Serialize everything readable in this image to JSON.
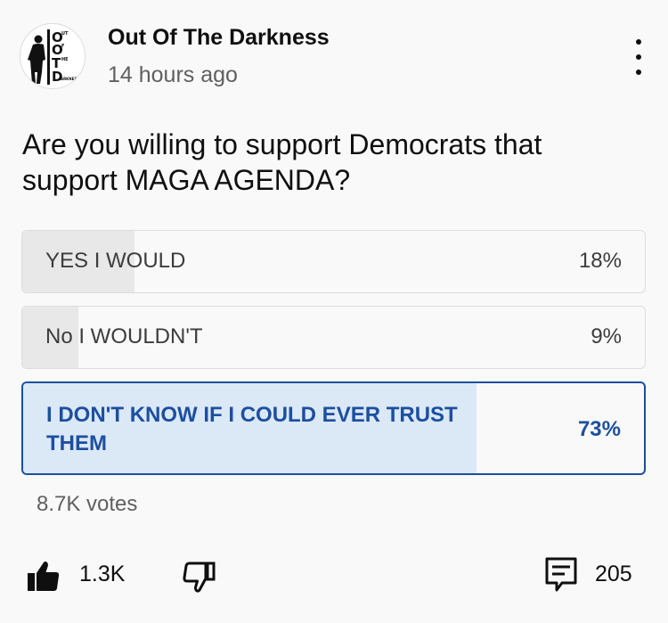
{
  "post": {
    "channel_name": "Out Of The Darkness",
    "timestamp": "14 hours ago",
    "avatar": {
      "logo_text_lines": [
        "O",
        "UT",
        "O",
        "F",
        "T",
        "HE",
        "D",
        "ARKNESS"
      ]
    },
    "question": "Are you willing to support Democrats that support MAGA AGENDA?"
  },
  "poll": {
    "options": [
      {
        "label": "YES I WOULD",
        "percent_text": "18%",
        "percent": 18,
        "selected": false
      },
      {
        "label": "No I WOULDN'T",
        "percent_text": "9%",
        "percent": 9,
        "selected": false
      },
      {
        "label": "I DON'T KNOW IF I COULD EVER TRUST THEM",
        "percent_text": "73%",
        "percent": 73,
        "selected": true
      }
    ],
    "votes": "8.7K votes"
  },
  "actions": {
    "likes": "1.3K",
    "comments": "205",
    "like_icon": "thumbs-up-filled",
    "dislike_icon": "thumbs-down-outline",
    "comment_icon": "comment-outline",
    "menu_icon": "more-vertical"
  },
  "colors": {
    "accent": "#1c4fa0",
    "selected_fill": "#dbe8f6",
    "option_fill": "#e8e8e8",
    "background": "#f9f9f9"
  }
}
